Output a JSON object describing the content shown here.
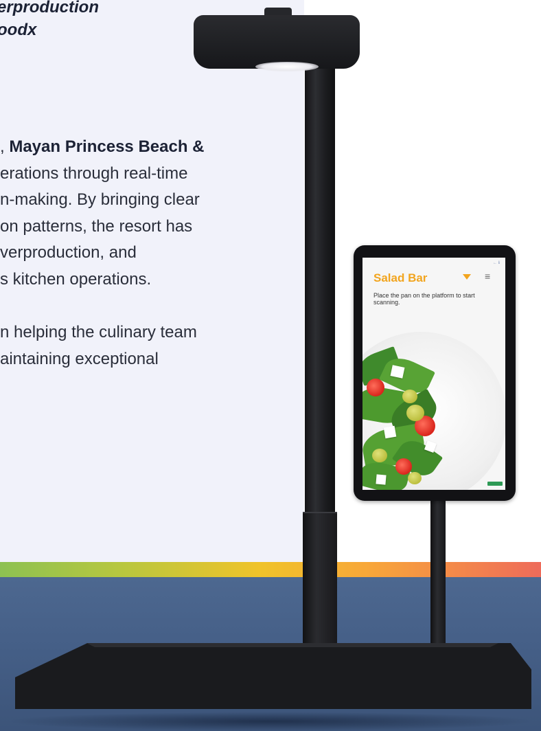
{
  "article": {
    "title_lines": [
      "erproduction",
      "oodx"
    ],
    "paragraph1_lines": [
      {
        "prefix": ", ",
        "bold": "Mayan Princess Beach &"
      },
      {
        "text": "erations through real-time"
      },
      {
        "text": "n-making. By bringing clear"
      },
      {
        "text": "on patterns, the resort has"
      },
      {
        "text": "verproduction, and"
      },
      {
        "text": "s kitchen operations."
      }
    ],
    "paragraph2_lines": [
      "n helping the culinary team",
      "aintaining exceptional"
    ]
  },
  "tablet_app": {
    "station_title": "Salad Bar",
    "instruction": "Place the pan on the platform to start scanning.",
    "status_icons": "← ℹ",
    "menu_icon": "hamburger-menu-icon",
    "dropdown_icon": "caret-down-icon",
    "accent_color": "#f2a51f",
    "start_button_color": "#2e9a56"
  },
  "colors": {
    "panel_background": "#f1f2fa",
    "floor": "#455f87",
    "rainbow_stripe": [
      "#8dc152",
      "#f0c32a",
      "#f8a739",
      "#ee6b5a"
    ]
  }
}
